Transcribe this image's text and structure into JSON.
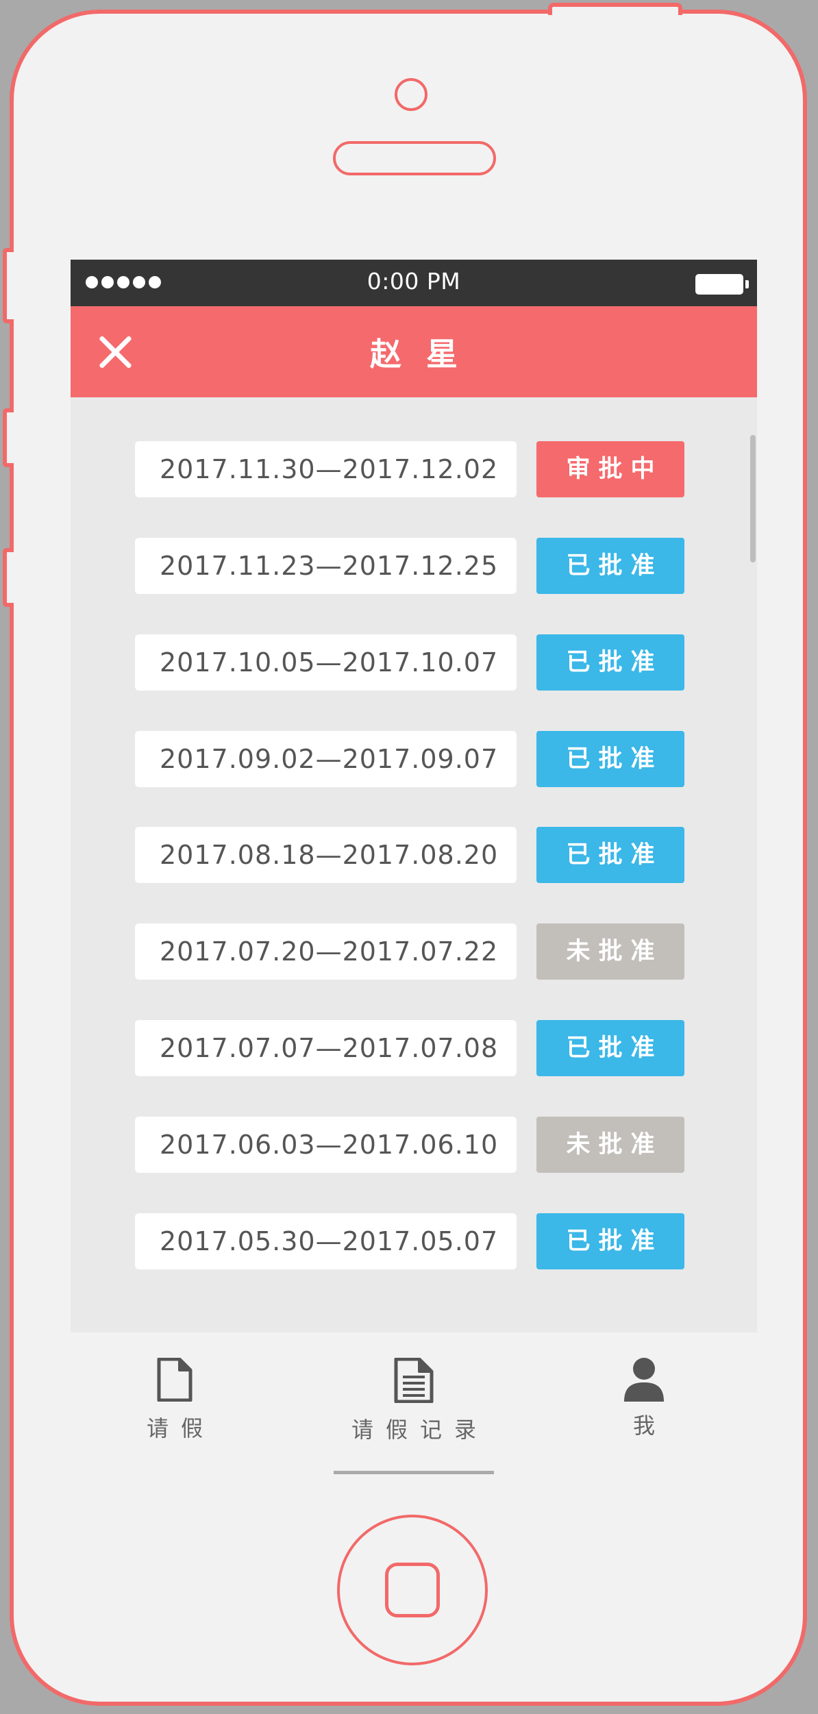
{
  "status_bar": {
    "time": "0:00 PM"
  },
  "header": {
    "title": "赵星"
  },
  "leave_records": [
    {
      "dates": "2017.11.30—2017.12.02",
      "status": "审批中",
      "color": "#f56a6d"
    },
    {
      "dates": "2017.11.23—2017.12.25",
      "status": "已批准",
      "color": "#3bb7e8"
    },
    {
      "dates": "2017.10.05—2017.10.07",
      "status": "已批准",
      "color": "#3bb7e8"
    },
    {
      "dates": "2017.09.02—2017.09.07",
      "status": "已批准",
      "color": "#3bb7e8"
    },
    {
      "dates": "2017.08.18—2017.08.20",
      "status": "已批准",
      "color": "#3bb7e8"
    },
    {
      "dates": "2017.07.20—2017.07.22",
      "status": "未批准",
      "color": "#c2bfba"
    },
    {
      "dates": "2017.07.07—2017.07.08",
      "status": "已批准",
      "color": "#3bb7e8"
    },
    {
      "dates": "2017.06.03—2017.06.10",
      "status": "未批准",
      "color": "#c2bfba"
    },
    {
      "dates": "2017.05.30—2017.05.07",
      "status": "已批准",
      "color": "#3bb7e8"
    }
  ],
  "tabs": [
    {
      "label": "请假",
      "icon": "document-icon"
    },
    {
      "label": "请假记录",
      "icon": "document-lines-icon",
      "active": true
    },
    {
      "label": "我",
      "icon": "user-icon"
    }
  ],
  "colors": {
    "accent": "#f56a6d",
    "approved": "#3bb7e8",
    "rejected": "#c2bfba"
  }
}
